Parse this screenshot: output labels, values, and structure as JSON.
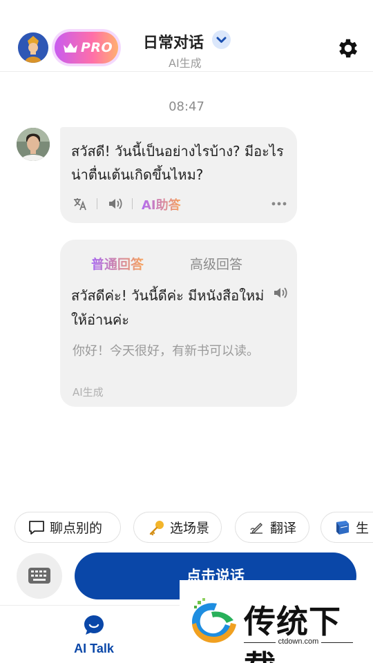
{
  "header": {
    "pro_label": "PRO",
    "title": "日常对话",
    "subtitle": "AI生成"
  },
  "chat": {
    "time": "08:47",
    "message": {
      "text": "สวัสดี! วันนี้เป็นอย่างไรบ้าง? มีอะไรน่าตื่นเต้นเกิดขึ้นไหม?",
      "ai_help_label": "AI助答"
    },
    "answer": {
      "tab_normal": "普通回答",
      "tab_advanced": "高级回答",
      "thai": "สวัสดีค่ะ! วันนี้ดีค่ะ มีหนังสือใหม่ให้อ่านค่ะ",
      "chinese": "你好！今天很好，有新书可以读。",
      "ai_label": "AI生成"
    }
  },
  "chips": [
    {
      "label": "聊点别的",
      "icon": "speech-bubble-icon"
    },
    {
      "label": "选场景",
      "icon": "key-icon"
    },
    {
      "label": "翻译",
      "icon": "writing-hand-icon"
    },
    {
      "label": "生",
      "icon": "book-icon"
    }
  ],
  "input": {
    "speak_label": "点击说话"
  },
  "tabbar": {
    "ai_talk_label": "AI Talk"
  },
  "watermark": {
    "text": "传统下载",
    "url": "ctdown.com"
  },
  "colors": {
    "primary": "#0a47a8",
    "pro_gradient_start": "#c85cf0",
    "pro_gradient_end": "#ffb070",
    "bubble": "#f1f1f1"
  }
}
